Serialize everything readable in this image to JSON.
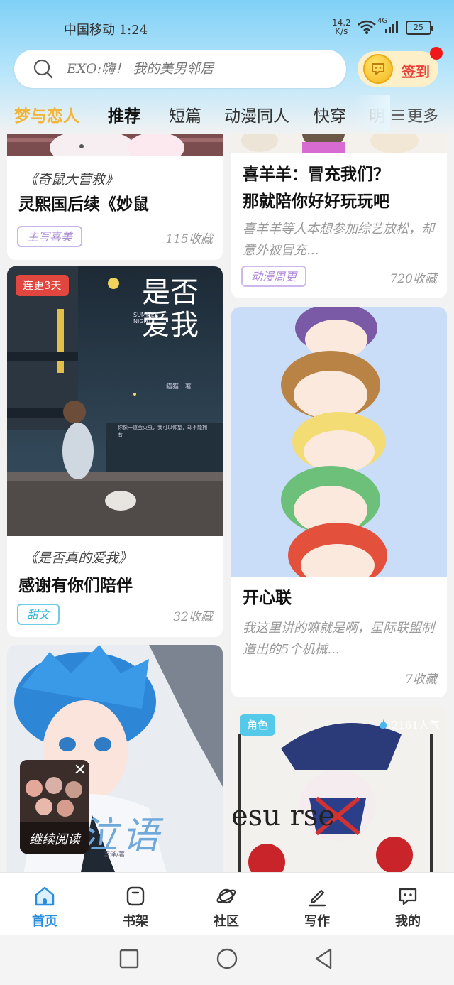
{
  "status_bar": {
    "carrier": "中国移动 1:24",
    "speed_value": "14.2",
    "speed_unit": "K/s",
    "network": "4G",
    "battery": "25"
  },
  "search": {
    "placeholder": "EXO:嗨！ 我的美男邻居"
  },
  "signin": {
    "label": "签到"
  },
  "tabs": [
    {
      "label": "梦与恋人"
    },
    {
      "label": "推荐"
    },
    {
      "label": "短篇"
    },
    {
      "label": "动漫同人"
    },
    {
      "label": "快穿"
    },
    {
      "label": "明"
    }
  ],
  "more_label": "更多",
  "feed": {
    "left": [
      {
        "subtitle": "《奇鼠大营救》",
        "title": "灵熙国后续《妙鼠",
        "tag": "主写喜美",
        "count": "115收藏"
      },
      {
        "badge": "连更3天",
        "cover_title": "是否爱我",
        "cover_en": "SUMMER NIGHT",
        "cover_author": "猫猫 | 著",
        "cover_quote": "你像一道萤火虫，我可以仰望，却不能拥有",
        "subtitle": "《是否真的爱我》",
        "title": "感谢有你们陪伴",
        "tag": "甜文",
        "count": "32收藏"
      },
      {
        "cover_word": "泣语",
        "cover_author": "言泽/著"
      }
    ],
    "right": [
      {
        "title_line1": "喜羊羊：冒充我们？",
        "title_line2": "那就陪你好好玩玩吧",
        "desc": "喜羊羊等人本想参加综艺放松，却意外被冒充...",
        "tag": "动漫周更",
        "count": "720收藏"
      },
      {
        "title": "开心联",
        "desc": "我这里讲的嘛就是啊，星际联盟制造出的5个机械...",
        "count": "7收藏"
      },
      {
        "badge": "角色",
        "popularity": "2161人气",
        "cover_text": "esu  rse"
      }
    ]
  },
  "resume": {
    "label": "继续阅读"
  },
  "bottom_nav": [
    {
      "label": "首页",
      "icon": "home-icon"
    },
    {
      "label": "书架",
      "icon": "bookshelf-icon"
    },
    {
      "label": "社区",
      "icon": "planet-icon"
    },
    {
      "label": "写作",
      "icon": "pen-icon"
    },
    {
      "label": "我的",
      "icon": "chat-icon"
    }
  ],
  "colors": {
    "accent_tab": "#f1b53a",
    "nav_active": "#2a8ede",
    "signin": "#e8423a"
  }
}
